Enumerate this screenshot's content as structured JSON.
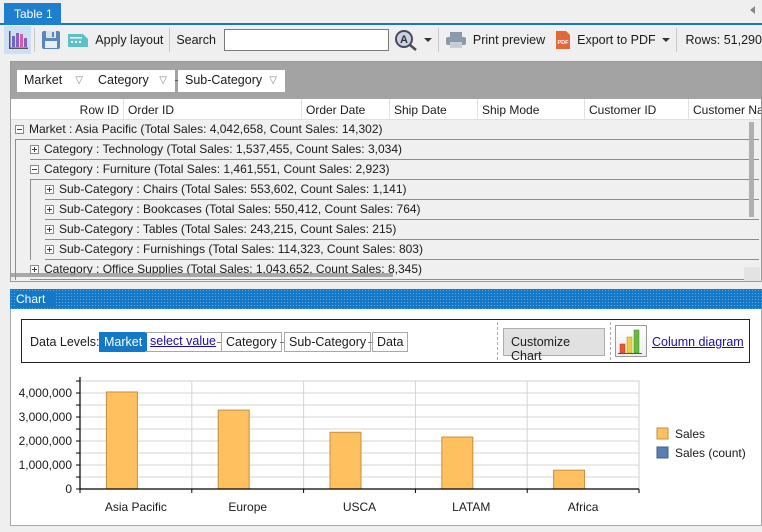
{
  "tabs": [
    {
      "label": "Table 1",
      "active": true
    }
  ],
  "toolbar": {
    "chart_toggle_icon": "bar-chart-icon",
    "save_icon": "floppy-disk-icon",
    "apply_layout_label": "Apply layout",
    "search_label": "Search",
    "search_value": "",
    "search_placeholder": "",
    "print_preview_label": "Print preview",
    "export_pdf_label": "Export to PDF",
    "rows_label": "Rows: 51,290"
  },
  "grid": {
    "group_by": [
      "Market",
      "Category",
      "Sub-Category"
    ],
    "columns": [
      "Row ID",
      "Order ID",
      "Order Date",
      "Ship Date",
      "Ship Mode",
      "Customer ID",
      "Customer Na"
    ],
    "rows": [
      {
        "level": 0,
        "expanded": true,
        "text": "Market : Asia Pacific (Total Sales: 4,042,658, Count Sales: 14,302)"
      },
      {
        "level": 1,
        "expanded": false,
        "text": "Category : Technology (Total Sales: 1,537,455, Count Sales: 3,034)"
      },
      {
        "level": 1,
        "expanded": true,
        "text": "Category : Furniture (Total Sales: 1,461,551, Count Sales: 2,923)"
      },
      {
        "level": 2,
        "expanded": false,
        "text": "Sub-Category : Chairs (Total Sales: 553,602, Count Sales: 1,141)"
      },
      {
        "level": 2,
        "expanded": false,
        "text": "Sub-Category : Bookcases (Total Sales: 550,412, Count Sales: 764)"
      },
      {
        "level": 2,
        "expanded": false,
        "text": "Sub-Category : Tables (Total Sales: 243,215, Count Sales: 215)"
      },
      {
        "level": 2,
        "expanded": false,
        "text": "Sub-Category : Furnishings (Total Sales: 114,323, Count Sales: 803)"
      },
      {
        "level": 1,
        "expanded": false,
        "text": "Category : Office Supplies (Total Sales: 1,043,652, Count Sales: 8,345)"
      }
    ]
  },
  "chart_panel": {
    "title": "Chart",
    "data_levels_label": "Data Levels:",
    "levels": [
      "Market",
      "Category",
      "Sub-Category",
      "Data"
    ],
    "active_level": "Market",
    "select_value_link": "select value",
    "customize_label": "Customize Chart",
    "diagram_type_link": "Column diagram"
  },
  "chart_data": {
    "type": "bar",
    "title": "",
    "xlabel": "",
    "ylabel": "",
    "categories": [
      "Asia Pacific",
      "Europe",
      "USCA",
      "LATAM",
      "Africa"
    ],
    "series": [
      {
        "name": "Sales",
        "values": [
          4042658,
          3287336,
          2364129,
          2164605,
          783773
        ],
        "color": "#ffc060"
      },
      {
        "name": "Sales (count)",
        "values": [],
        "color": "#5b7fb0"
      }
    ],
    "ylim": [
      0,
      4500000
    ],
    "yticks": [
      0,
      1000000,
      2000000,
      3000000,
      4000000
    ],
    "ytick_labels": [
      "0",
      "1,000,000",
      "2,000,000",
      "3,000,000",
      "4,000,000"
    ],
    "grid": true,
    "legend": "right"
  },
  "colors": {
    "accent": "#1478c8",
    "bar_fill": "#ffc060",
    "bar_stroke": "#c09040"
  }
}
